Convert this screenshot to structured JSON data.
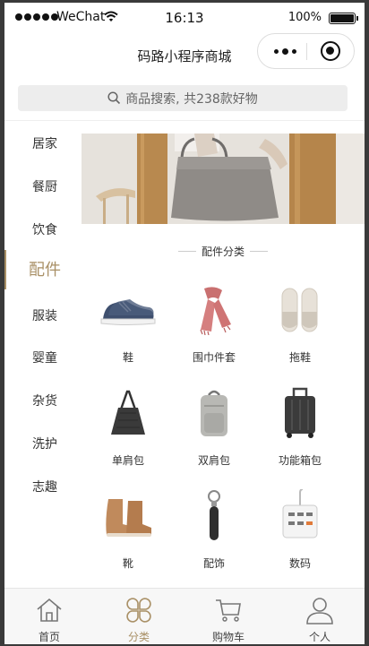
{
  "status_bar": {
    "carrier": "WeChat",
    "time": "16:13",
    "battery": "100%",
    "battery_level": 1.0
  },
  "navbar": {
    "title": "码路小程序商城"
  },
  "search": {
    "placeholder": "商品搜索, 共238款好物"
  },
  "sidebar": {
    "items": [
      {
        "label": "居家"
      },
      {
        "label": "餐厨"
      },
      {
        "label": "饮食"
      },
      {
        "label": "配件",
        "active": true
      },
      {
        "label": "服装"
      },
      {
        "label": "婴童"
      },
      {
        "label": "杂货"
      },
      {
        "label": "洗护"
      },
      {
        "label": "志趣"
      }
    ]
  },
  "section": {
    "title": "配件分类"
  },
  "categories": [
    {
      "label": "鞋",
      "icon": "sneaker-image"
    },
    {
      "label": "围巾件套",
      "icon": "scarf-image"
    },
    {
      "label": "拖鞋",
      "icon": "slipper-image"
    },
    {
      "label": "单肩包",
      "icon": "shoulder-bag-image"
    },
    {
      "label": "双肩包",
      "icon": "backpack-image"
    },
    {
      "label": "功能箱包",
      "icon": "suitcase-image"
    },
    {
      "label": "靴",
      "icon": "boot-image"
    },
    {
      "label": "配饰",
      "icon": "keychain-image"
    },
    {
      "label": "数码",
      "icon": "power-strip-image"
    }
  ],
  "tabbar": {
    "items": [
      {
        "label": "首页",
        "icon": "home-icon"
      },
      {
        "label": "分类",
        "icon": "category-icon",
        "active": true
      },
      {
        "label": "购物车",
        "icon": "cart-icon"
      },
      {
        "label": "个人",
        "icon": "user-icon"
      }
    ]
  },
  "colors": {
    "accent": "#a99066",
    "text": "#333333",
    "search_bg": "#ededed",
    "tabbar_bg": "#f7f7f7"
  }
}
